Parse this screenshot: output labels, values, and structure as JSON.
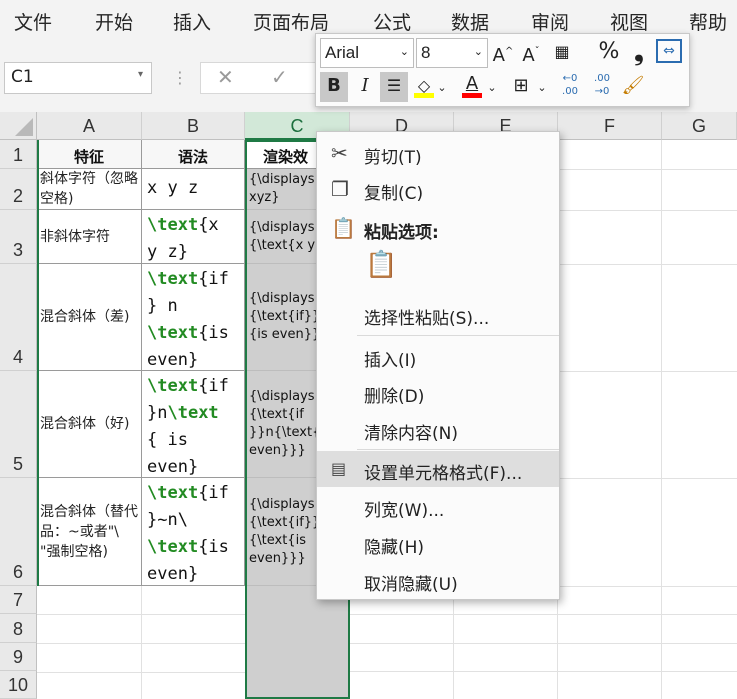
{
  "ribbon": {
    "tabs": [
      "文件",
      "开始",
      "插入",
      "页面布局",
      "公式",
      "数据",
      "审阅",
      "视图",
      "帮助"
    ]
  },
  "formula_bar": {
    "name_box": "C1",
    "cancel_icon": "✕",
    "confirm_icon": "✓"
  },
  "mini_toolbar": {
    "font": "Arial",
    "size": "8",
    "bold": "B",
    "italic": "I",
    "percent": "%",
    "comma": "❟",
    "fill_color": "#ffff00",
    "font_color": "#ff0000"
  },
  "columns": [
    "A",
    "B",
    "C",
    "D",
    "E",
    "F",
    "G"
  ],
  "rows": [
    "1",
    "2",
    "3",
    "4",
    "5",
    "6",
    "7",
    "8",
    "9",
    "10"
  ],
  "table": {
    "headers": [
      "特征",
      "语法",
      "渲染效"
    ],
    "rows": [
      {
        "a": "斜体字符（忽略空格)",
        "b_plain": "x y z",
        "c": "{\\displays xyz}"
      },
      {
        "a": "非斜体字符",
        "c": "{\\displays {\\text{x y z"
      },
      {
        "a": "混合斜体（差)",
        "c": "{\\displays {\\text{if}}n {is even}}"
      },
      {
        "a": "混合斜体（好)",
        "c": "{\\displays {\\text{if }}n{\\text{ is even}}}"
      },
      {
        "a": "混合斜体（替代品：~或者\"\\ \"强制空格)",
        "c": "{\\displays {\\text{if}}~ {\\text{is even}}}"
      }
    ],
    "code": {
      "r3": [
        [
          "\\text",
          "{x"
        ],
        [
          "",
          "y z}"
        ]
      ],
      "r4": [
        [
          "\\text",
          "{if"
        ],
        [
          "",
          "} n"
        ],
        [
          "\\text",
          "{is"
        ],
        [
          "",
          "even}"
        ]
      ],
      "r5": [
        [
          "\\text",
          "{if"
        ],
        [
          "",
          " }n"
        ],
        [
          "\\text",
          ""
        ],
        [
          "",
          "{ is"
        ],
        [
          "",
          "even}"
        ]
      ],
      "r6": [
        [
          "\\text",
          "{if"
        ],
        [
          "",
          "}~n\\"
        ],
        [
          "\\text",
          "{is"
        ],
        [
          "",
          "even}"
        ]
      ]
    }
  },
  "context_menu": {
    "items": [
      {
        "label": "剪切(T)",
        "icon": "scissors-icon"
      },
      {
        "label": "复制(C)",
        "icon": "copy-icon"
      },
      {
        "label": "粘贴选项:",
        "icon": "paste-icon"
      },
      {
        "label": "选择性粘贴(S)...",
        "icon": ""
      },
      {
        "label": "插入(I)",
        "icon": ""
      },
      {
        "label": "删除(D)",
        "icon": ""
      },
      {
        "label": "清除内容(N)",
        "icon": ""
      },
      {
        "label": "设置单元格格式(F)...",
        "icon": "format-cells-icon"
      },
      {
        "label": "列宽(W)...",
        "icon": ""
      },
      {
        "label": "隐藏(H)",
        "icon": ""
      },
      {
        "label": "取消隐藏(U)",
        "icon": ""
      }
    ],
    "highlighted": "设置单元格格式(F)..."
  }
}
